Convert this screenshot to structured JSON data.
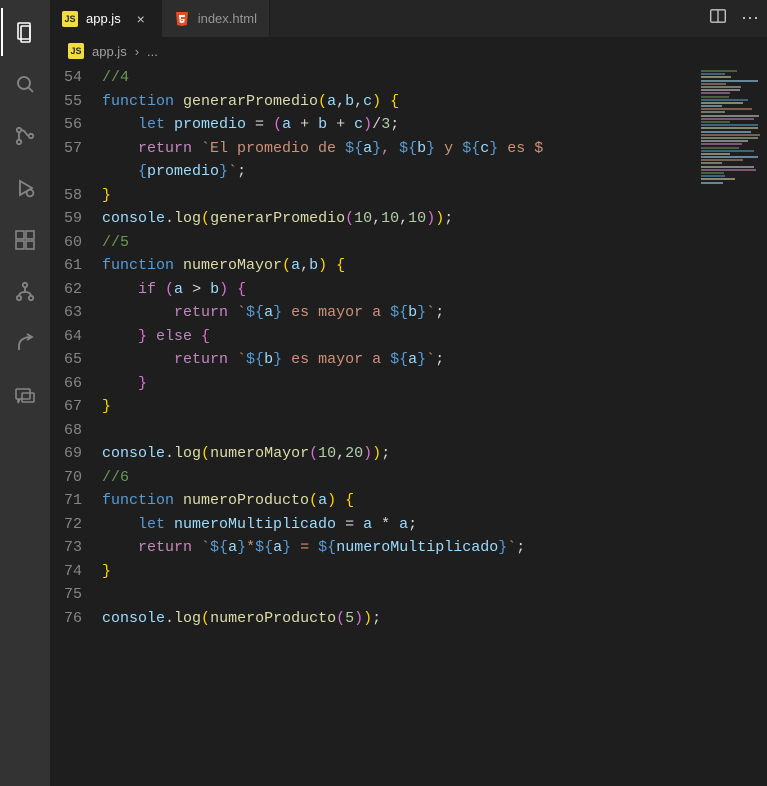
{
  "activityBar": {
    "items": [
      {
        "name": "explorer-icon",
        "active": true
      },
      {
        "name": "search-icon",
        "active": false
      },
      {
        "name": "source-control-icon",
        "active": false
      },
      {
        "name": "run-debug-icon",
        "active": false
      },
      {
        "name": "extensions-icon",
        "active": false
      },
      {
        "name": "git-graph-icon",
        "active": false
      },
      {
        "name": "share-icon",
        "active": false
      },
      {
        "name": "comment-icon",
        "active": false
      }
    ]
  },
  "tabs": [
    {
      "label": "app.js",
      "iconType": "js",
      "active": true,
      "close": "×"
    },
    {
      "label": "index.html",
      "iconType": "html",
      "active": false,
      "close": ""
    }
  ],
  "tabActions": {
    "split": "split-editor-icon",
    "more": "⋯"
  },
  "breadcrumb": {
    "fileIconType": "js",
    "file": "app.js",
    "separator": "›",
    "trail": "..."
  },
  "code": {
    "startLine": 54,
    "lines": [
      [
        {
          "t": "//4",
          "c": "c-comment"
        }
      ],
      [
        {
          "t": "function ",
          "c": "c-keyword"
        },
        {
          "t": "generarPromedio",
          "c": "c-funcdecl"
        },
        {
          "t": "(",
          "c": "c-brace"
        },
        {
          "t": "a",
          "c": "c-param"
        },
        {
          "t": ",",
          "c": "c-punct"
        },
        {
          "t": "b",
          "c": "c-param"
        },
        {
          "t": ",",
          "c": "c-punct"
        },
        {
          "t": "c",
          "c": "c-param"
        },
        {
          "t": ") ",
          "c": "c-brace"
        },
        {
          "t": "{",
          "c": "c-brace"
        }
      ],
      [
        {
          "t": "    ",
          "c": ""
        },
        {
          "t": "let ",
          "c": "c-keyword"
        },
        {
          "t": "promedio",
          "c": "c-var"
        },
        {
          "t": " = ",
          "c": "c-punct"
        },
        {
          "t": "(",
          "c": "c-brace2"
        },
        {
          "t": "a",
          "c": "c-var"
        },
        {
          "t": " + ",
          "c": "c-punct"
        },
        {
          "t": "b",
          "c": "c-var"
        },
        {
          "t": " + ",
          "c": "c-punct"
        },
        {
          "t": "c",
          "c": "c-var"
        },
        {
          "t": ")",
          "c": "c-brace2"
        },
        {
          "t": "/",
          "c": "c-punct"
        },
        {
          "t": "3",
          "c": "c-number"
        },
        {
          "t": ";",
          "c": "c-punct"
        }
      ],
      [
        {
          "t": "    ",
          "c": ""
        },
        {
          "t": "return ",
          "c": "c-control"
        },
        {
          "t": "`El promedio de ",
          "c": "c-string"
        },
        {
          "t": "${",
          "c": "c-tplbrace"
        },
        {
          "t": "a",
          "c": "c-var"
        },
        {
          "t": "}",
          "c": "c-tplbrace"
        },
        {
          "t": ", ",
          "c": "c-string"
        },
        {
          "t": "${",
          "c": "c-tplbrace"
        },
        {
          "t": "b",
          "c": "c-var"
        },
        {
          "t": "}",
          "c": "c-tplbrace"
        },
        {
          "t": " y ",
          "c": "c-string"
        },
        {
          "t": "${",
          "c": "c-tplbrace"
        },
        {
          "t": "c",
          "c": "c-var"
        },
        {
          "t": "}",
          "c": "c-tplbrace"
        },
        {
          "t": " es ",
          "c": "c-string"
        },
        {
          "t": "$",
          "c": "c-string"
        }
      ],
      [
        {
          "t": "    ",
          "c": ""
        },
        {
          "t": "{",
          "c": "c-tplbrace"
        },
        {
          "t": "promedio",
          "c": "c-var"
        },
        {
          "t": "}",
          "c": "c-tplbrace"
        },
        {
          "t": "`",
          "c": "c-string"
        },
        {
          "t": ";",
          "c": "c-punct"
        }
      ],
      [
        {
          "t": "}",
          "c": "c-brace"
        }
      ],
      [
        {
          "t": "console",
          "c": "c-object"
        },
        {
          "t": ".",
          "c": "c-punct"
        },
        {
          "t": "log",
          "c": "c-funccall"
        },
        {
          "t": "(",
          "c": "c-brace"
        },
        {
          "t": "generarPromedio",
          "c": "c-funccall"
        },
        {
          "t": "(",
          "c": "c-brace2"
        },
        {
          "t": "10",
          "c": "c-number"
        },
        {
          "t": ",",
          "c": "c-punct"
        },
        {
          "t": "10",
          "c": "c-number"
        },
        {
          "t": ",",
          "c": "c-punct"
        },
        {
          "t": "10",
          "c": "c-number"
        },
        {
          "t": ")",
          "c": "c-brace2"
        },
        {
          "t": ")",
          "c": "c-brace"
        },
        {
          "t": ";",
          "c": "c-punct"
        }
      ],
      [
        {
          "t": "//5",
          "c": "c-comment"
        }
      ],
      [
        {
          "t": "function ",
          "c": "c-keyword"
        },
        {
          "t": "numeroMayor",
          "c": "c-funcdecl"
        },
        {
          "t": "(",
          "c": "c-brace"
        },
        {
          "t": "a",
          "c": "c-param"
        },
        {
          "t": ",",
          "c": "c-punct"
        },
        {
          "t": "b",
          "c": "c-param"
        },
        {
          "t": ") ",
          "c": "c-brace"
        },
        {
          "t": "{",
          "c": "c-brace"
        }
      ],
      [
        {
          "t": "    ",
          "c": ""
        },
        {
          "t": "if ",
          "c": "c-control"
        },
        {
          "t": "(",
          "c": "c-brace2"
        },
        {
          "t": "a",
          "c": "c-var"
        },
        {
          "t": " > ",
          "c": "c-punct"
        },
        {
          "t": "b",
          "c": "c-var"
        },
        {
          "t": ") ",
          "c": "c-brace2"
        },
        {
          "t": "{",
          "c": "c-brace2"
        }
      ],
      [
        {
          "t": "        ",
          "c": ""
        },
        {
          "t": "return ",
          "c": "c-control"
        },
        {
          "t": "`",
          "c": "c-string"
        },
        {
          "t": "${",
          "c": "c-tplbrace"
        },
        {
          "t": "a",
          "c": "c-var"
        },
        {
          "t": "}",
          "c": "c-tplbrace"
        },
        {
          "t": " es mayor a ",
          "c": "c-string"
        },
        {
          "t": "${",
          "c": "c-tplbrace"
        },
        {
          "t": "b",
          "c": "c-var"
        },
        {
          "t": "}",
          "c": "c-tplbrace"
        },
        {
          "t": "`",
          "c": "c-string"
        },
        {
          "t": ";",
          "c": "c-punct"
        }
      ],
      [
        {
          "t": "    ",
          "c": ""
        },
        {
          "t": "} ",
          "c": "c-brace2"
        },
        {
          "t": "else ",
          "c": "c-control"
        },
        {
          "t": "{",
          "c": "c-brace2"
        }
      ],
      [
        {
          "t": "        ",
          "c": ""
        },
        {
          "t": "return ",
          "c": "c-control"
        },
        {
          "t": "`",
          "c": "c-string"
        },
        {
          "t": "${",
          "c": "c-tplbrace"
        },
        {
          "t": "b",
          "c": "c-var"
        },
        {
          "t": "}",
          "c": "c-tplbrace"
        },
        {
          "t": " es mayor a ",
          "c": "c-string"
        },
        {
          "t": "${",
          "c": "c-tplbrace"
        },
        {
          "t": "a",
          "c": "c-var"
        },
        {
          "t": "}",
          "c": "c-tplbrace"
        },
        {
          "t": "`",
          "c": "c-string"
        },
        {
          "t": ";",
          "c": "c-punct"
        }
      ],
      [
        {
          "t": "    ",
          "c": ""
        },
        {
          "t": "}",
          "c": "c-brace2"
        }
      ],
      [
        {
          "t": "}",
          "c": "c-brace"
        }
      ],
      [
        {
          "t": "",
          "c": ""
        }
      ],
      [
        {
          "t": "console",
          "c": "c-object"
        },
        {
          "t": ".",
          "c": "c-punct"
        },
        {
          "t": "log",
          "c": "c-funccall"
        },
        {
          "t": "(",
          "c": "c-brace"
        },
        {
          "t": "numeroMayor",
          "c": "c-funccall"
        },
        {
          "t": "(",
          "c": "c-brace2"
        },
        {
          "t": "10",
          "c": "c-number"
        },
        {
          "t": ",",
          "c": "c-punct"
        },
        {
          "t": "20",
          "c": "c-number"
        },
        {
          "t": ")",
          "c": "c-brace2"
        },
        {
          "t": ")",
          "c": "c-brace"
        },
        {
          "t": ";",
          "c": "c-punct"
        }
      ],
      [
        {
          "t": "//6",
          "c": "c-comment"
        }
      ],
      [
        {
          "t": "function ",
          "c": "c-keyword"
        },
        {
          "t": "numeroProducto",
          "c": "c-funcdecl"
        },
        {
          "t": "(",
          "c": "c-brace"
        },
        {
          "t": "a",
          "c": "c-param"
        },
        {
          "t": ") ",
          "c": "c-brace"
        },
        {
          "t": "{",
          "c": "c-brace"
        }
      ],
      [
        {
          "t": "    ",
          "c": ""
        },
        {
          "t": "let ",
          "c": "c-keyword"
        },
        {
          "t": "numeroMultiplicado",
          "c": "c-var"
        },
        {
          "t": " = ",
          "c": "c-punct"
        },
        {
          "t": "a",
          "c": "c-var"
        },
        {
          "t": " * ",
          "c": "c-punct"
        },
        {
          "t": "a",
          "c": "c-var"
        },
        {
          "t": ";",
          "c": "c-punct"
        }
      ],
      [
        {
          "t": "    ",
          "c": ""
        },
        {
          "t": "return ",
          "c": "c-control"
        },
        {
          "t": "`",
          "c": "c-string"
        },
        {
          "t": "${",
          "c": "c-tplbrace"
        },
        {
          "t": "a",
          "c": "c-var"
        },
        {
          "t": "}",
          "c": "c-tplbrace"
        },
        {
          "t": "*",
          "c": "c-string"
        },
        {
          "t": "${",
          "c": "c-tplbrace"
        },
        {
          "t": "a",
          "c": "c-var"
        },
        {
          "t": "}",
          "c": "c-tplbrace"
        },
        {
          "t": " = ",
          "c": "c-string"
        },
        {
          "t": "${",
          "c": "c-tplbrace"
        },
        {
          "t": "numeroMultiplicado",
          "c": "c-var"
        },
        {
          "t": "}",
          "c": "c-tplbrace"
        },
        {
          "t": "`",
          "c": "c-string"
        },
        {
          "t": ";",
          "c": "c-punct"
        }
      ],
      [
        {
          "t": "}",
          "c": "c-brace"
        }
      ],
      [
        {
          "t": "",
          "c": ""
        }
      ],
      [
        {
          "t": "console",
          "c": "c-object"
        },
        {
          "t": ".",
          "c": "c-punct"
        },
        {
          "t": "log",
          "c": "c-funccall"
        },
        {
          "t": "(",
          "c": "c-brace"
        },
        {
          "t": "numeroProducto",
          "c": "c-funccall"
        },
        {
          "t": "(",
          "c": "c-brace2"
        },
        {
          "t": "5",
          "c": "c-number"
        },
        {
          "t": ")",
          "c": "c-brace2"
        },
        {
          "t": ")",
          "c": "c-brace"
        },
        {
          "t": ";",
          "c": "c-punct"
        }
      ]
    ],
    "wrapIndices": [
      4
    ]
  }
}
